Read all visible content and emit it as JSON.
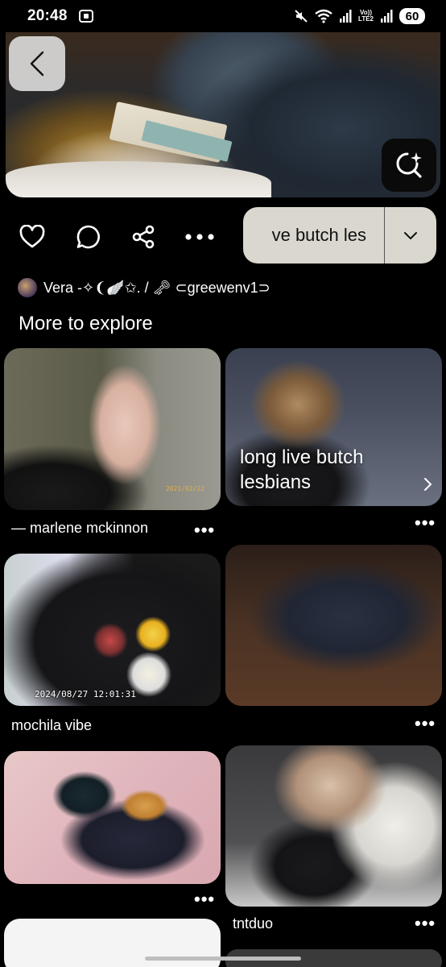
{
  "status_bar": {
    "time": "20:48",
    "volte_top": "Vo))",
    "volte_bottom": "LTE2",
    "battery": "60"
  },
  "hero": {
    "back_label": "Back",
    "lens_label": "Visual search"
  },
  "actions": {
    "board_name": "long live butch lesbians",
    "board_name_visible": "ve butch les"
  },
  "creator": {
    "name": "Vera -✧❨🪽✩. / 🗝 ⊂greewenv1⊃"
  },
  "section": {
    "title": "More to explore"
  },
  "pins": [
    {
      "caption": "— marlene mckinnon",
      "date_stamp": "2021/02/22"
    },
    {
      "overlay_title_line1": "long live butch",
      "overlay_title_line2": "lesbians"
    },
    {
      "caption": "mochila vibe",
      "date_stamp": "2024/08/27  12:01:31"
    },
    {
      "caption": ""
    },
    {
      "caption": ""
    },
    {
      "caption": "tntduo"
    }
  ],
  "more_label": "•••",
  "icons": {
    "back": "chevron-left-icon",
    "lens": "visual-search-icon",
    "like": "heart-icon",
    "comment": "comment-icon",
    "share": "share-icon",
    "more": "more-icon",
    "board_dropdown": "chevron-down-icon"
  }
}
